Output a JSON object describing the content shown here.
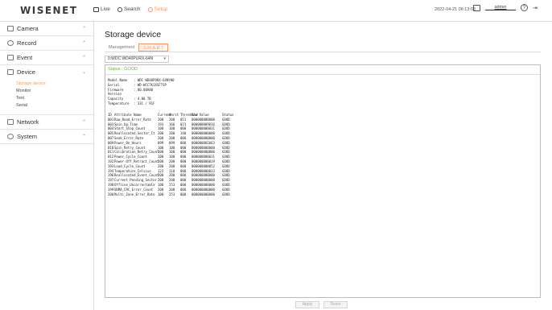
{
  "app": {
    "logo": "WISENET"
  },
  "topnav": [
    {
      "label": "Live",
      "icon": "monitor-icon",
      "active": false
    },
    {
      "label": "Search",
      "icon": "search-icon",
      "active": false
    },
    {
      "label": "Setup",
      "icon": "gear-icon",
      "active": true
    }
  ],
  "header": {
    "datetime": "2022-04-21 06:13:08",
    "user": "admin",
    "help": "?"
  },
  "sidebar": {
    "groups": [
      {
        "label": "Camera",
        "icon": "camera-icon",
        "expanded": false,
        "items": []
      },
      {
        "label": "Record",
        "icon": "record-icon",
        "expanded": false,
        "items": []
      },
      {
        "label": "Event",
        "icon": "event-icon",
        "expanded": false,
        "items": []
      },
      {
        "label": "Device",
        "icon": "device-icon",
        "expanded": true,
        "items": [
          "Storage device",
          "Monitor",
          "Text",
          "Serial"
        ],
        "active_item": 0
      },
      {
        "label": "Network",
        "icon": "network-icon",
        "expanded": false,
        "items": []
      },
      {
        "label": "System",
        "icon": "system-icon",
        "expanded": false,
        "items": []
      }
    ]
  },
  "main": {
    "title": "Storage device",
    "tabs": [
      {
        "label": "Management",
        "active": false
      },
      {
        "label": "S.M.A.R.T",
        "active": true
      }
    ],
    "device_select": "0:WDC WD40PURX-64N",
    "status": "Status : GOOD",
    "info": [
      {
        "key": "Model Name",
        "value": ": WDC WD40PURX-64NYH0"
      },
      {
        "key": "Serial",
        "value": ": WD-WCC7K1XSFTSP"
      },
      {
        "key": "Firmware Version",
        "value": ": 80.00A80"
      },
      {
        "key": "Capacity",
        "value": ": 4.00 TB"
      },
      {
        "key": "Temperature",
        "value": ": 33C / 91F"
      }
    ],
    "smart_header": [
      "ID",
      "Attribute Name",
      "Current",
      "Worst",
      "Threshold",
      "Raw Value",
      "Status"
    ],
    "smart_rows": [
      [
        "001",
        "Raw_Read_Error_Rate",
        "200",
        "200",
        "051",
        "000000000000",
        "GOOD"
      ],
      [
        "003",
        "Spin_Up_Time",
        "193",
        "166",
        "021",
        "000000009016",
        "GOOD"
      ],
      [
        "004",
        "Start_Stop_Count",
        "100",
        "100",
        "000",
        "000000000031",
        "GOOD"
      ],
      [
        "005",
        "Reallocated_Sector_Ct",
        "200",
        "200",
        "140",
        "000000000000",
        "GOOD"
      ],
      [
        "007",
        "Seek_Error_Rate",
        "200",
        "200",
        "000",
        "000000000000",
        "GOOD"
      ],
      [
        "009",
        "Power_On_Hours",
        "099",
        "099",
        "000",
        "000000001063",
        "GOOD"
      ],
      [
        "010",
        "Spin_Retry_Count",
        "100",
        "100",
        "000",
        "000000000000",
        "GOOD"
      ],
      [
        "011",
        "Calibration_Retry_Count",
        "100",
        "100",
        "000",
        "000000000000",
        "GOOD"
      ],
      [
        "012",
        "Power_Cycle_Count",
        "100",
        "100",
        "000",
        "000000000031",
        "GOOD"
      ],
      [
        "192",
        "Power-Off_Retract_Count",
        "200",
        "200",
        "000",
        "000000000019",
        "GOOD"
      ],
      [
        "193",
        "Load_Cycle_Count",
        "200",
        "200",
        "000",
        "000000000052",
        "GOOD"
      ],
      [
        "194",
        "Temperature_Celsius",
        "122",
        "110",
        "000",
        "000000000033",
        "GOOD"
      ],
      [
        "196",
        "Reallocated_Event_Count",
        "200",
        "200",
        "000",
        "000000000000",
        "GOOD"
      ],
      [
        "197",
        "Current_Pending_Sector",
        "200",
        "200",
        "000",
        "000000000000",
        "GOOD"
      ],
      [
        "198",
        "Offline_Uncorrectable",
        "100",
        "253",
        "000",
        "000000000000",
        "GOOD"
      ],
      [
        "199",
        "UDMA_CRC_Error_Count",
        "200",
        "200",
        "000",
        "000000000000",
        "GOOD"
      ],
      [
        "200",
        "Multi_Zone_Error_Rate",
        "100",
        "253",
        "000",
        "000000000000",
        "GOOD"
      ]
    ],
    "buttons": {
      "apply": "Apply",
      "reset": "Reset"
    }
  },
  "colors": {
    "accent": "#f39a6b",
    "status_good": "#6ab04c"
  }
}
